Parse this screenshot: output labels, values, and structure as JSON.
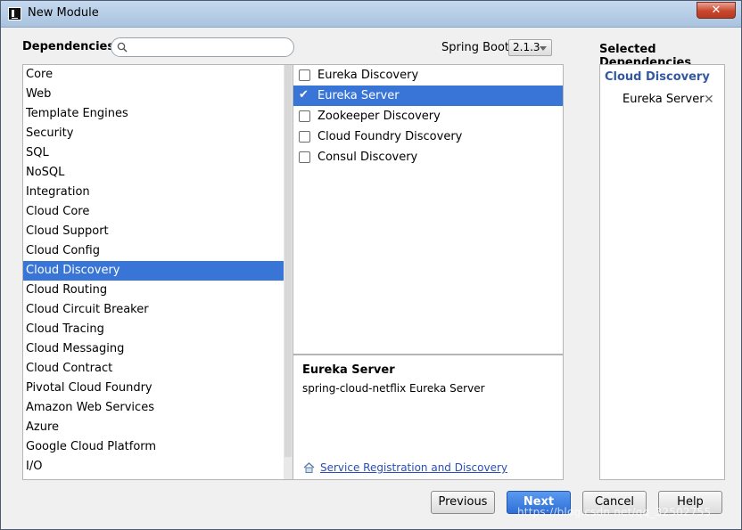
{
  "window": {
    "title": "New Module",
    "close_label": "✕"
  },
  "header": {
    "dependencies_label": "Dependencies",
    "search_placeholder": "",
    "spring_boot_label": "Spring Boot",
    "spring_boot_version": "2.1.3",
    "selected_label": "Selected Dependencies"
  },
  "categories": [
    "Core",
    "Web",
    "Template Engines",
    "Security",
    "SQL",
    "NoSQL",
    "Integration",
    "Cloud Core",
    "Cloud Support",
    "Cloud Config",
    "Cloud Discovery",
    "Cloud Routing",
    "Cloud Circuit Breaker",
    "Cloud Tracing",
    "Cloud Messaging",
    "Cloud Contract",
    "Pivotal Cloud Foundry",
    "Amazon Web Services",
    "Azure",
    "Google Cloud Platform",
    "I/O"
  ],
  "selected_category_index": 10,
  "dependencies": [
    {
      "label": "Eureka Discovery",
      "checked": false
    },
    {
      "label": "Eureka Server",
      "checked": true
    },
    {
      "label": "Zookeeper Discovery",
      "checked": false
    },
    {
      "label": "Cloud Foundry Discovery",
      "checked": false
    },
    {
      "label": "Consul Discovery",
      "checked": false
    }
  ],
  "selected_dependency_index": 1,
  "description": {
    "title": "Eureka Server",
    "text": "spring-cloud-netflix Eureka Server",
    "link": "Service Registration and Discovery"
  },
  "selected_panel": {
    "group": "Cloud Discovery",
    "items": [
      "Eureka Server"
    ]
  },
  "buttons": {
    "previous": "Previous",
    "next": "Next",
    "cancel": "Cancel",
    "help": "Help"
  },
  "watermark": "https://blog.csdn.net/qq_32502755",
  "colors": {
    "selection": "#3875d7",
    "link": "#2a4fb0",
    "group_header": "#35599e"
  }
}
